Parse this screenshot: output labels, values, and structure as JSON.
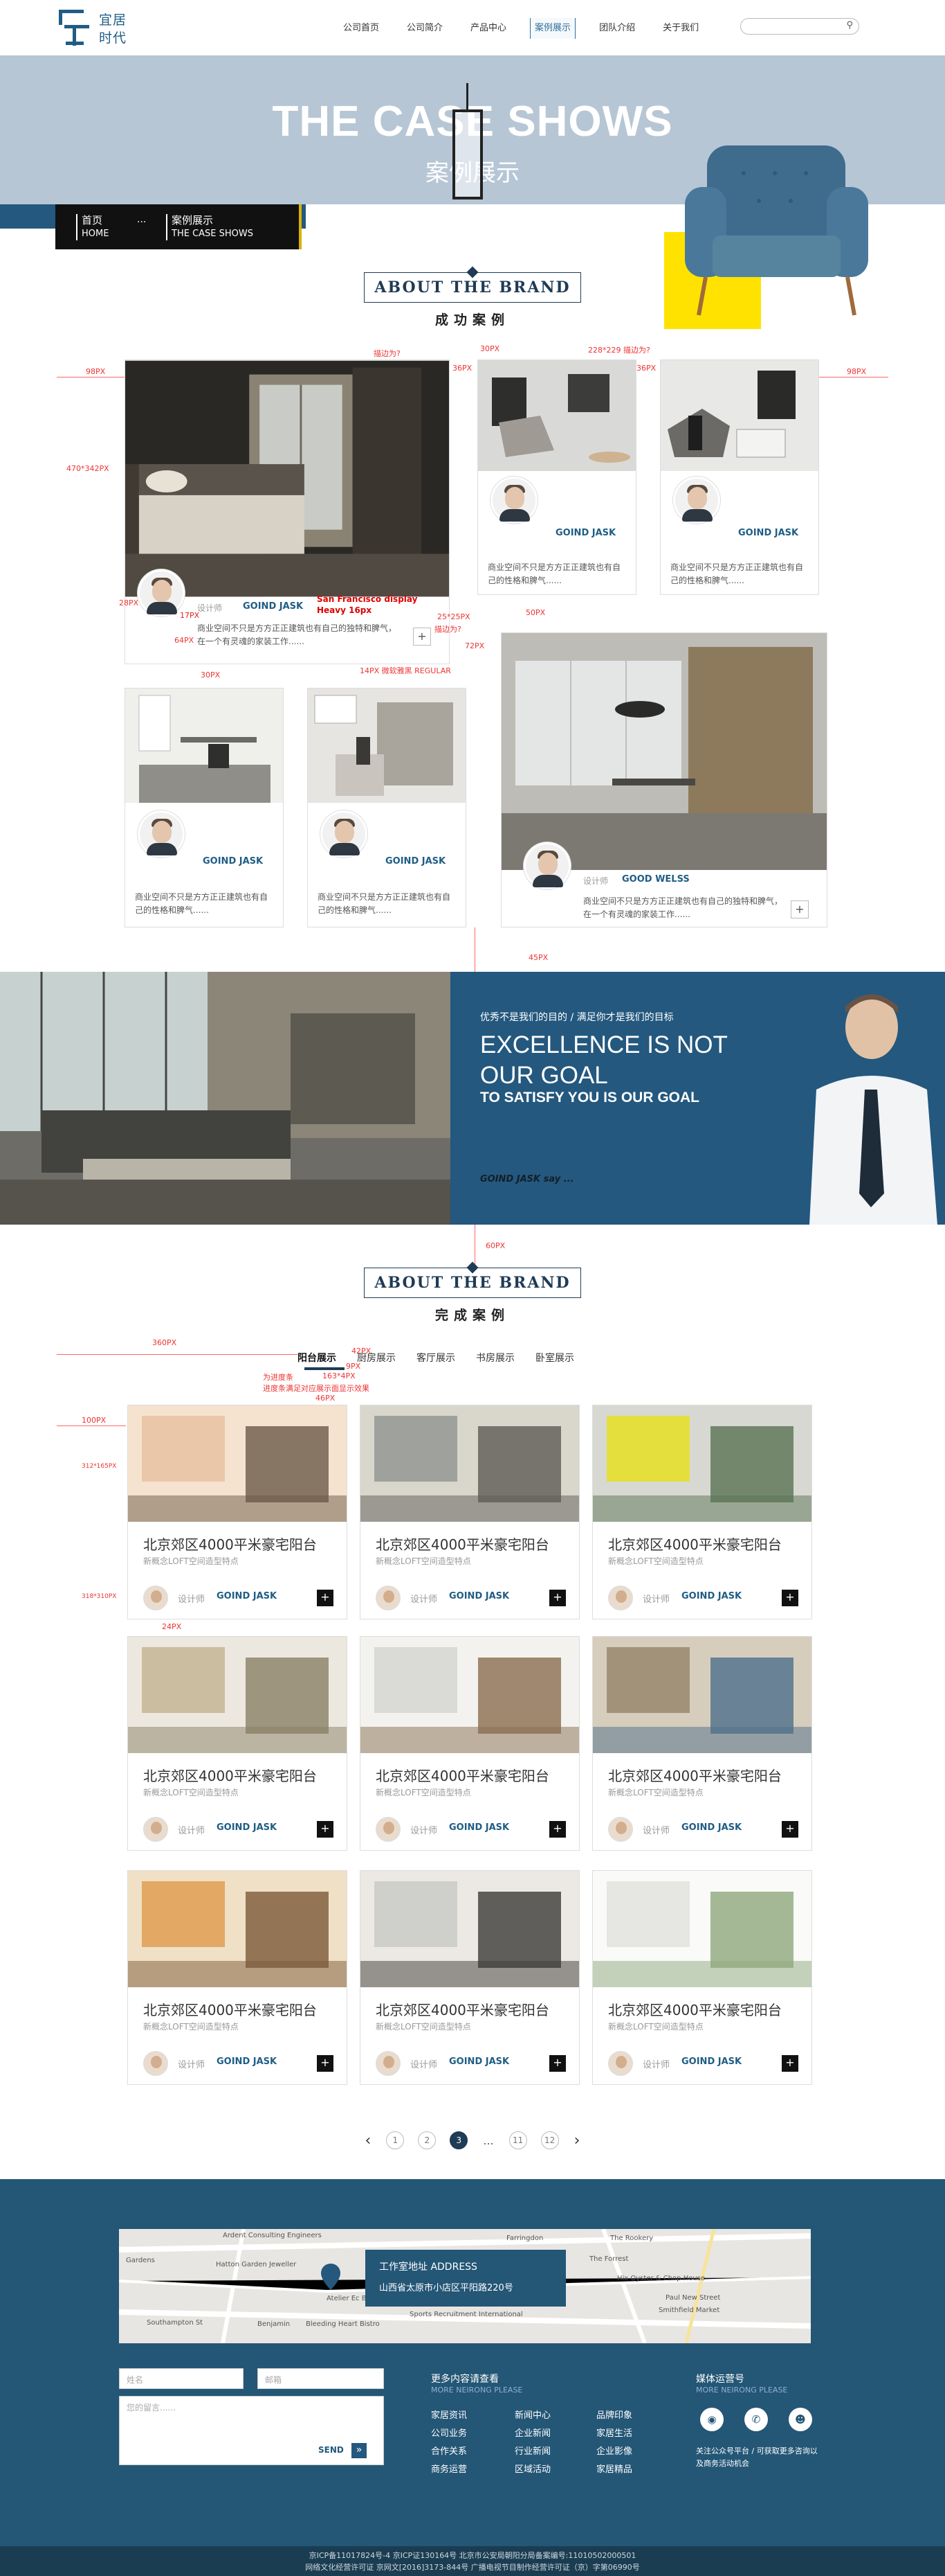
{
  "header": {
    "logo_cn1": "宜居",
    "logo_cn2": "时代",
    "nav": [
      "公司首页",
      "公司简介",
      "产品中心",
      "案例展示",
      "团队介绍",
      "关于我们"
    ],
    "nav_active_index": 3,
    "search_icon": "search-icon"
  },
  "banner": {
    "title_en": "THE CASE SHOWS",
    "title_cn": "案例展示",
    "crumb_home_cn": "首页",
    "crumb_home_en": "HOME",
    "crumb_dots": "···",
    "crumb_cur_cn": "案例展示",
    "crumb_cur_en": "THE CASE SHOWS"
  },
  "section1": {
    "en": "ABOUT THE BRAND",
    "cn": "成功案例"
  },
  "section2": {
    "en": "ABOUT THE BRAND",
    "cn": "完成案例"
  },
  "cases": {
    "big_author": "GOIND JASK",
    "big_role": "设计师",
    "big_desc": "商业空间不只是方方正正建筑也有自己的独特和脾气，在一个有灵魂的家装工作......",
    "tr1_author": "GOIND JASK",
    "tr1_desc": "商业空间不只是方方正正建筑也有自己的性格和脾气......",
    "tr2_author": "GOIND JASK",
    "tr2_desc": "商业空间不只是方方正正建筑也有自己的性格和脾气......",
    "bl1_author": "GOIND JASK",
    "bl1_desc": "商业空间不只是方方正正建筑也有自己的性格和脾气......",
    "bl2_author": "GOIND JASK",
    "bl2_desc": "商业空间不只是方方正正建筑也有自己的性格和脾气......",
    "br_role": "设计师",
    "br_author": "GOOD WELSS",
    "br_desc": "商业空间不只是方方正正建筑也有自己的独特和脾气，在一个有灵魂的家装工作......",
    "plus": "+"
  },
  "annotations": {
    "a98l": "98PX",
    "a98r": "98PX",
    "a470": "470*342PX",
    "a_border1": "描边为?",
    "a30": "30PX",
    "a36": "36PX",
    "a228": "228*229 描边为?",
    "a36b": "36PX",
    "a28": "28PX",
    "a17": "17PX",
    "a_font": "San Francisco display",
    "a_font2": "Heavy   16px",
    "a64": "64PX",
    "a25": "25*25PX",
    "a_border2": "描边为?",
    "a72": "72PX",
    "a14": "14PX 微软雅黑  REGULAR",
    "a30b": "30PX",
    "a50": "50PX",
    "a45": "45PX",
    "a60": "60PX",
    "a42": "42PX",
    "a360": "360PX",
    "a9": "9PX",
    "a163": "163*4PX",
    "a_prog": "为进度条",
    "a_prog2": "进度条满足对应展示面显示效果",
    "a46": "46PX",
    "a100": "100PX",
    "a312": "312*165PX",
    "a318": "318*310PX",
    "a24": "24PX"
  },
  "promo": {
    "small": "优秀不是我们的目的 / 满足你才是我们的目标",
    "big1": "EXCELLENCE IS NOT OUR GOAL",
    "big2": "TO SATISFY YOU IS OUR GOAL",
    "say": "GOIND JASK say ..."
  },
  "tabs": [
    "阳台展示",
    "厨房展示",
    "客厅展示",
    "书房展示",
    "卧室展示"
  ],
  "projects": {
    "title": "北京郊区4000平米豪宅阳台",
    "sub": "新概念LOFT空间造型特点",
    "role": "设计师",
    "author": "GOIND JASK",
    "btn": "+"
  },
  "pager": {
    "pages": [
      "1",
      "2",
      "3",
      "...",
      "11",
      "12"
    ],
    "current": "3",
    "prev": "‹",
    "next": "›"
  },
  "footer": {
    "addr_title": "工作室地址 ADDRESS",
    "addr": "山西省太原市小店区平阳路220号",
    "map_labels": [
      "Farringdon",
      "The Rookery",
      "Ardent Consulting Engineers",
      "Hatton Garden Jeweller",
      "The Forrest",
      "Hix Oyster & Chop House",
      "Paul New Street",
      "Smithfield Market",
      "Sports Recruitment International",
      "Benjamin",
      "Bleeding Heart Bistro",
      "Atelier Ec Bridge",
      "Gardens",
      "Southampton St"
    ],
    "name_ph": "姓名",
    "mail_ph": "邮箱",
    "msg_ph": "您的留言......",
    "send": "SEND",
    "more_cn": "更多内容请查看",
    "more_en": "MORE NEIRONG PLEASE",
    "links": [
      "家居资讯",
      "新闻中心",
      "品牌印象",
      "公司业务",
      "企业新闻",
      "家居生活",
      "合作关系",
      "行业新闻",
      "企业影像",
      "商务运营",
      "区域活动",
      "家居精品"
    ],
    "media_cn": "媒体运营号",
    "media_en": "MORE NEIRONG PLEASE",
    "follow": "关注公众号平台 / 可获取更多咨询以及商务活动机会",
    "copy1": "京ICP备11017824号-4 京ICP证130164号 北京市公安局朝阳分局备案编号:11010502000501",
    "copy2": "网络文化经营许可证 京网文[2016]3173-844号 广播电视节目制作经营许可证（京）字第06990号"
  },
  "colors": {
    "brand": "#24587e",
    "accent": "#ffe200",
    "dark": "#1f3b55"
  }
}
